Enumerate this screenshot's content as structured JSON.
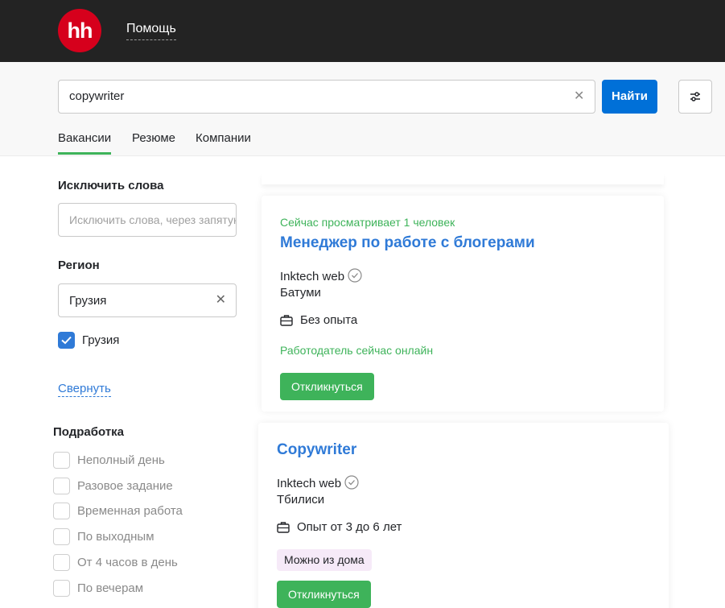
{
  "header": {
    "logo_text": "hh",
    "help_label": "Помощь"
  },
  "search": {
    "query": "copywriter",
    "find_label": "Найти"
  },
  "tabs": [
    {
      "label": "Вакансии",
      "active": true
    },
    {
      "label": "Резюме",
      "active": false
    },
    {
      "label": "Компании",
      "active": false
    }
  ],
  "sidebar": {
    "exclude_heading": "Исключить слова",
    "exclude_placeholder": "Исключить слова, через запятую",
    "region_heading": "Регион",
    "region_value": "Грузия",
    "region_checkbox_label": "Грузия",
    "collapse_label": "Свернуть",
    "parttime_heading": "Подработка",
    "parttime_options": [
      "Неполный день",
      "Разовое задание",
      "Временная работа",
      "По выходным",
      "От 4 часов в день",
      "По вечерам"
    ]
  },
  "vacancies": [
    {
      "viewing": "Сейчас просматривает 1 человек",
      "title": "Менеджер по работе с блогерами",
      "company": "Inktech web",
      "city": "Батуми",
      "experience": "Без опыта",
      "status": "Работодатель сейчас онлайн",
      "apply_label": "Откликнуться"
    },
    {
      "title": "Copywriter",
      "company": "Inktech web",
      "city": "Тбилиси",
      "experience": "Опыт от 3 до 6 лет",
      "badge": "Можно из дома",
      "apply_label": "Откликнуться"
    }
  ],
  "colors": {
    "brand_red": "#d6001c",
    "primary_blue": "#0070d8",
    "link_blue": "#2f7ad7",
    "success_green": "#3eb35a"
  }
}
